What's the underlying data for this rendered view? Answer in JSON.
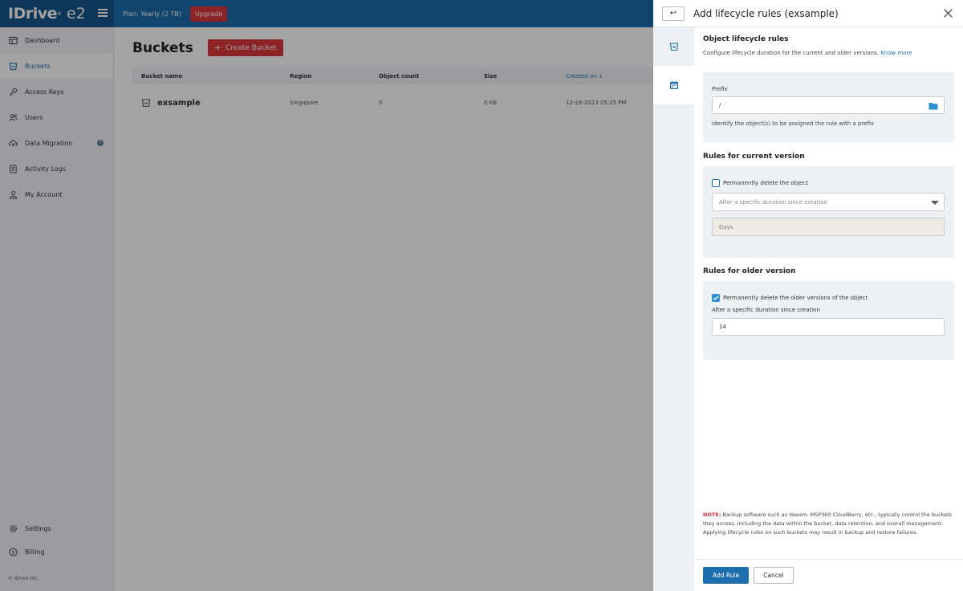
{
  "app": {
    "brand": "IDrive",
    "brand_reg": "®",
    "brand_suffix": "e2",
    "plan": "Plan: Yearly (2 TB)",
    "upgrade_label": "Upgrade",
    "copyright": "© IDrive Inc."
  },
  "sidebar": {
    "items": [
      {
        "label": "Dashboard",
        "icon": "dashboard-icon"
      },
      {
        "label": "Buckets",
        "icon": "bucket-icon",
        "active": true
      },
      {
        "label": "Access Keys",
        "icon": "key-icon"
      },
      {
        "label": "Users",
        "icon": "users-icon"
      },
      {
        "label": "Data Migration",
        "icon": "cloud-migration-icon",
        "badge": "?"
      },
      {
        "label": "Activity Logs",
        "icon": "document-icon"
      },
      {
        "label": "My Account",
        "icon": "user-icon"
      }
    ],
    "bottom_items": [
      {
        "label": "Settings",
        "icon": "gear-icon"
      },
      {
        "label": "Billing",
        "icon": "dollar-icon"
      }
    ]
  },
  "main": {
    "title": "Buckets",
    "create_label": "Create Bucket",
    "columns": [
      "Bucket name",
      "Region",
      "Object count",
      "Size",
      "Created on"
    ],
    "sort_indicator": "↓",
    "rows": [
      {
        "name": "exsample",
        "region": "Singapore",
        "count": "0",
        "size": "0 KB",
        "created": "12-16-2023 05:25 PM"
      }
    ]
  },
  "panel": {
    "back_label": "↩",
    "title": "Add lifecycle rules (exsample)",
    "section_title": "Object lifecycle rules",
    "section_desc": "Configure lifecycle duration for the current and older versions.",
    "know_more": "Know more",
    "prefix_label": "Prefix",
    "prefix_value": "/",
    "prefix_helper": "Identify the object(s) to be assigned the rule with a prefix",
    "current_title": "Rules for current version",
    "current_check_label": "Permanently delete the object",
    "current_checked": false,
    "current_select": "After a specific duration since creation",
    "days_placeholder": "Days",
    "older_title": "Rules for older version",
    "older_check_label": "Permanently delete the older versions of the object",
    "older_checked": true,
    "older_duration_label": "After a specific duration since creation",
    "older_days_value": "14",
    "note_label": "NOTE:",
    "note_text": "Backup software such as Veeam, MSP360 CloudBerry, etc., typically control the buckets they access, including the data within the bucket, data retention, and overall management. Applying lifecycle rules on such buckets may result in backup and restore failures.",
    "add_rule_label": "Add Rule",
    "cancel_label": "Cancel"
  },
  "colors": {
    "primary": "#1d6ead",
    "danger": "#d9373e",
    "sidebar_bg": "#f4f5f7",
    "card_bg": "#eef1f4"
  }
}
